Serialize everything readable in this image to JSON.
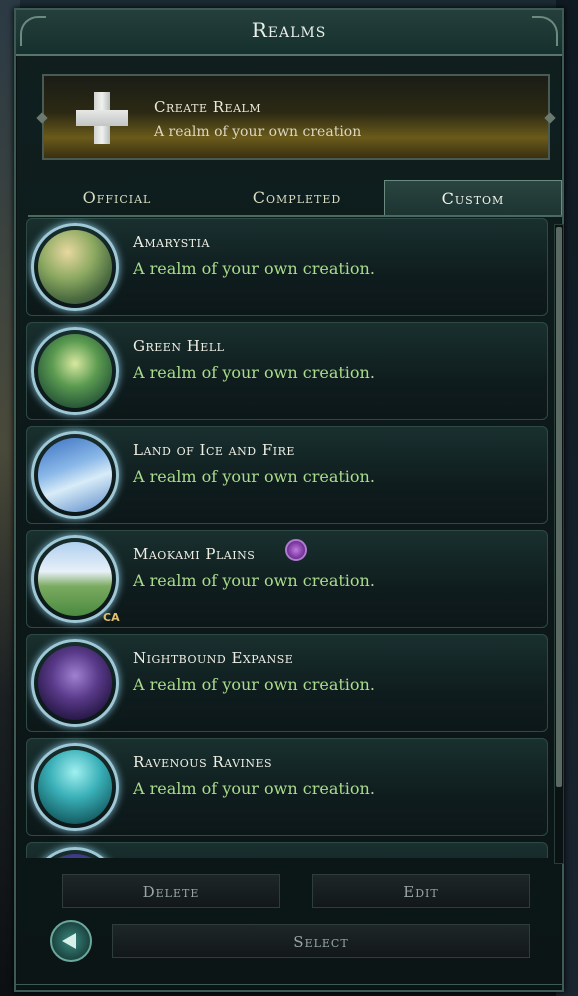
{
  "header": {
    "title": "Realms"
  },
  "create_realm": {
    "title": "Create Realm",
    "subtitle": "A realm of your own creation"
  },
  "tabs": [
    {
      "label": "Official",
      "active": false
    },
    {
      "label": "Completed",
      "active": false
    },
    {
      "label": "Custom",
      "active": true
    }
  ],
  "realms": [
    {
      "name": "Amarystia",
      "description": "A realm of your own creation."
    },
    {
      "name": "Green Hell",
      "description": "A realm of your own creation."
    },
    {
      "name": "Land of Ice and Fire",
      "description": "A realm of your own creation."
    },
    {
      "name": "Maokami Plains",
      "description": "A realm of your own creation.",
      "badge_icon": "purple-emblem-icon",
      "dlc_label": "CA"
    },
    {
      "name": "Nightbound Expanse",
      "description": "A realm of your own creation."
    },
    {
      "name": "Ravenous Ravines",
      "description": "A realm of your own creation."
    }
  ],
  "buttons": {
    "delete": "Delete",
    "edit": "Edit",
    "select": "Select"
  },
  "colors": {
    "accent_green_text": "#a9dc8c",
    "panel_border": "#3e5a54"
  }
}
